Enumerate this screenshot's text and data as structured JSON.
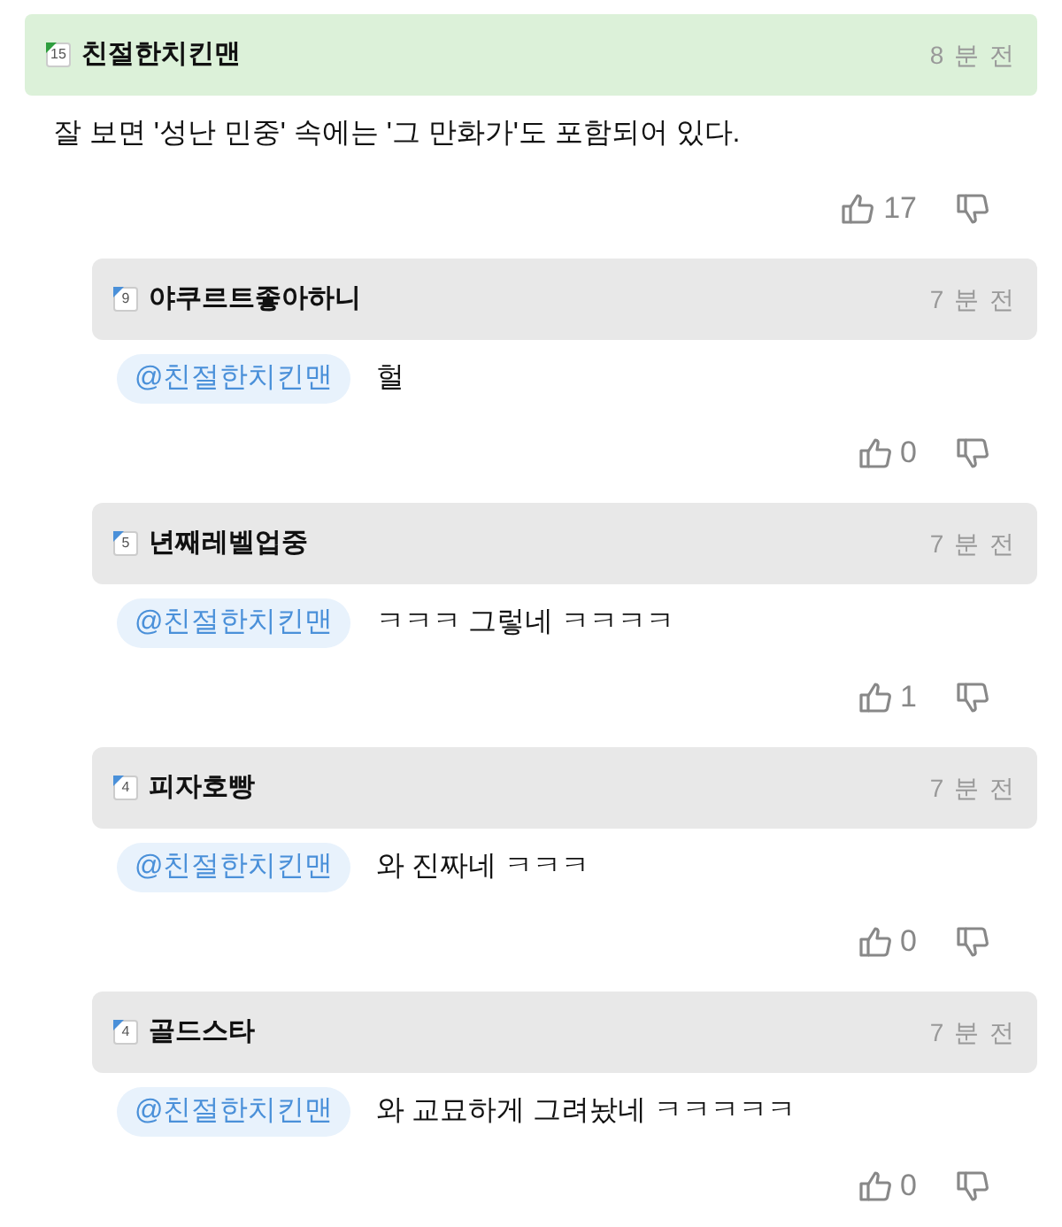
{
  "comment": {
    "author": "친절한치킨맨",
    "level": "15",
    "color": "#2e9e3e",
    "time": "8 분 전",
    "text": "잘 보면 '성난 민중' 속에는 '그 만화가'도 포함되어 있다.",
    "likes": "17"
  },
  "replies": [
    {
      "author": "야쿠르트좋아하니",
      "level": "9",
      "color": "#4a90d9",
      "time": "7 분 전",
      "mention": "@친절한치킨맨",
      "text": "헐",
      "likes": "0"
    },
    {
      "author": "년째레벨업중",
      "level": "5",
      "color": "#4a90d9",
      "time": "7 분 전",
      "mention": "@친절한치킨맨",
      "text": "ㅋㅋㅋ 그렇네 ㅋㅋㅋㅋ",
      "likes": "1"
    },
    {
      "author": "피자호빵",
      "level": "4",
      "color": "#4a90d9",
      "time": "7 분 전",
      "mention": "@친절한치킨맨",
      "text": "와 진짜네 ㅋㅋㅋ",
      "likes": "0"
    },
    {
      "author": "골드스타",
      "level": "4",
      "color": "#4a90d9",
      "time": "7 분 전",
      "mention": "@친절한치킨맨",
      "text": "와 교묘하게 그려놨네 ㅋㅋㅋㅋㅋ",
      "likes": "0"
    }
  ]
}
